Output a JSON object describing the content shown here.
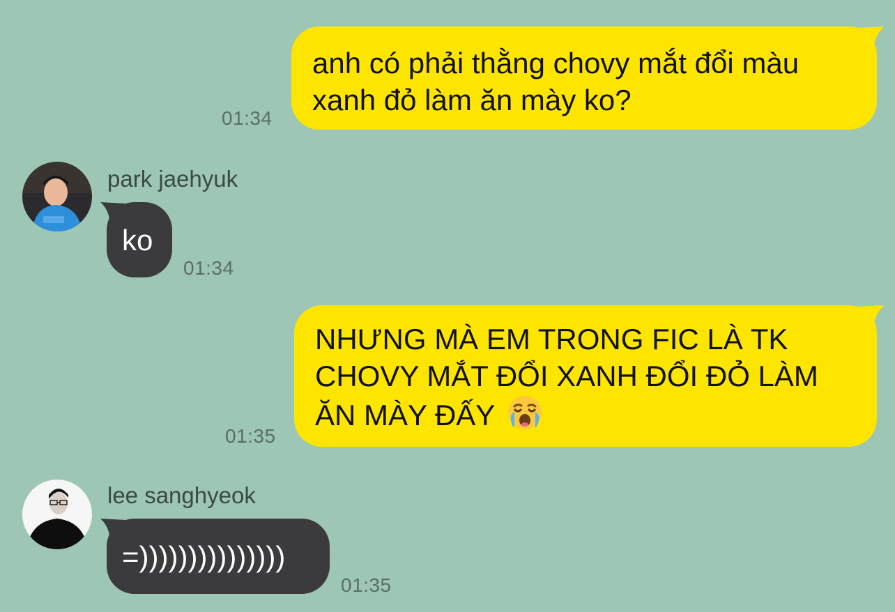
{
  "colors": {
    "background": "#9dc6b4",
    "outgoing_bubble": "#fee500",
    "incoming_bubble": "#3b3b3d",
    "timestamp": "#5a6e66"
  },
  "messages": [
    {
      "direction": "outgoing",
      "lines": [
        "anh có phải thằng chovy mắt đổi màu",
        "xanh đỏ làm ăn mày ko?"
      ],
      "time": "01:34"
    },
    {
      "direction": "incoming",
      "sender": "park jaehyuk",
      "avatar_icon": "boy-blue-shirt-avatar-icon",
      "lines": [
        "ko"
      ],
      "time": "01:34"
    },
    {
      "direction": "outgoing",
      "lines": [
        "NHƯNG MÀ EM TRONG FIC LÀ TK",
        "CHOVY MẮT ĐỔI XANH ĐỔI ĐỎ LÀM",
        "ĂN MÀY ĐẤY"
      ],
      "emoji": "loudly-crying-face-emoji",
      "time": "01:35"
    },
    {
      "direction": "incoming",
      "sender": "lee sanghyeok",
      "avatar_icon": "man-glasses-black-outfit-avatar-icon",
      "lines": [
        "=)))))))))))))))"
      ],
      "time": "01:35"
    }
  ]
}
